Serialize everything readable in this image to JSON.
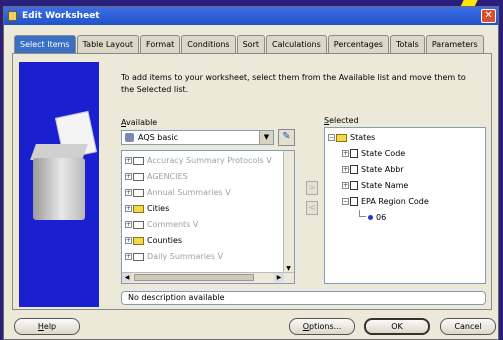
{
  "window": {
    "title": "Edit Worksheet",
    "close_glyph": "✕"
  },
  "tabs": [
    {
      "label": "Select Items",
      "active": true
    },
    {
      "label": "Table Layout"
    },
    {
      "label": "Format"
    },
    {
      "label": "Conditions"
    },
    {
      "label": "Sort"
    },
    {
      "label": "Calculations"
    },
    {
      "label": "Percentages"
    },
    {
      "label": "Totals"
    },
    {
      "label": "Parameters"
    }
  ],
  "instructions": "To add items to your worksheet, select them from the Available list and move them to the Selected list.",
  "available": {
    "label_mnemonic": "A",
    "label_rest": "vailable",
    "business_area": "AQS basic",
    "items": [
      {
        "label": "Accuracy Summary Protocols V",
        "muted": true,
        "folder": "white"
      },
      {
        "label": "AGENCIES",
        "muted": true,
        "folder": "white"
      },
      {
        "label": "Annual Summaries V",
        "muted": true,
        "folder": "white"
      },
      {
        "label": "Cities",
        "muted": false,
        "folder": "yellow"
      },
      {
        "label": "Comments V",
        "muted": true,
        "folder": "white"
      },
      {
        "label": "Counties",
        "muted": false,
        "folder": "yellow"
      },
      {
        "label": "Daily Summaries V",
        "muted": true,
        "folder": "white"
      }
    ]
  },
  "selected": {
    "label_mnemonic": "S",
    "label_rest": "elected",
    "root": "States",
    "children": [
      {
        "label": "State Code"
      },
      {
        "label": "State Abbr"
      },
      {
        "label": "State Name"
      },
      {
        "label": "EPA Region Code"
      }
    ],
    "leaf": "06"
  },
  "move_buttons": {
    "add": ">",
    "remove": "<"
  },
  "description": "No description available",
  "buttons": {
    "help_mnemonic": "H",
    "help_rest": "elp",
    "options_mnemonic": "O",
    "options_rest": "ptions...",
    "ok": "OK",
    "cancel": "Cancel"
  },
  "colors": {
    "active_tab": "#3a6fc4",
    "side_art": "#1a1fcf",
    "titlebar": "#2052c8"
  }
}
